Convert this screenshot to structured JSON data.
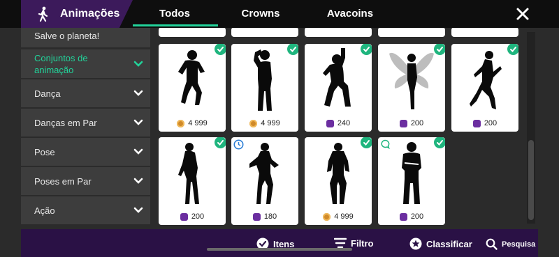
{
  "header": {
    "title": "Animações",
    "tabs": [
      {
        "label": "Todos",
        "active": true
      },
      {
        "label": "Crowns",
        "active": false
      },
      {
        "label": "Avacoins",
        "active": false
      }
    ]
  },
  "sidebar": {
    "items": [
      {
        "label": "Salve o planeta!",
        "active": false
      },
      {
        "label": "Conjuntos de animação",
        "active": true
      },
      {
        "label": "Dança",
        "active": false
      },
      {
        "label": "Danças em Par",
        "active": false
      },
      {
        "label": "Pose",
        "active": false
      },
      {
        "label": "Poses em Par",
        "active": false
      },
      {
        "label": "Ação",
        "active": false
      }
    ]
  },
  "grid": {
    "rows": [
      [
        {
          "price": "4 999",
          "currency": "gold",
          "owned": true,
          "pose": "jump"
        },
        {
          "price": "4 999",
          "currency": "gold",
          "owned": true,
          "pose": "salute"
        },
        {
          "price": "240",
          "currency": "purple",
          "owned": true,
          "pose": "point-up"
        },
        {
          "price": "200",
          "currency": "purple",
          "owned": true,
          "pose": "fairy"
        },
        {
          "price": "200",
          "currency": "purple",
          "owned": true,
          "pose": "float"
        }
      ],
      [
        {
          "price": "200",
          "currency": "purple",
          "owned": true,
          "pose": "lean"
        },
        {
          "price": "180",
          "currency": "purple",
          "owned": false,
          "badge": "clock-icon",
          "pose": "hip"
        },
        {
          "price": "4 999",
          "currency": "gold",
          "owned": true,
          "pose": "stand"
        },
        {
          "price": "200",
          "currency": "purple",
          "owned": true,
          "badge": "chat-icon",
          "pose": "arms-crossed"
        }
      ]
    ]
  },
  "bottom_bar": {
    "items_label": "Itens",
    "filter_label": "Filtro",
    "sort_label": "Classificar",
    "search_label": "Pesquisa"
  },
  "colors": {
    "accent": "#22d39a",
    "header_purple": "#3c1a5b",
    "bottom_purple": "#2a1145",
    "check_green": "#1fb57e"
  }
}
